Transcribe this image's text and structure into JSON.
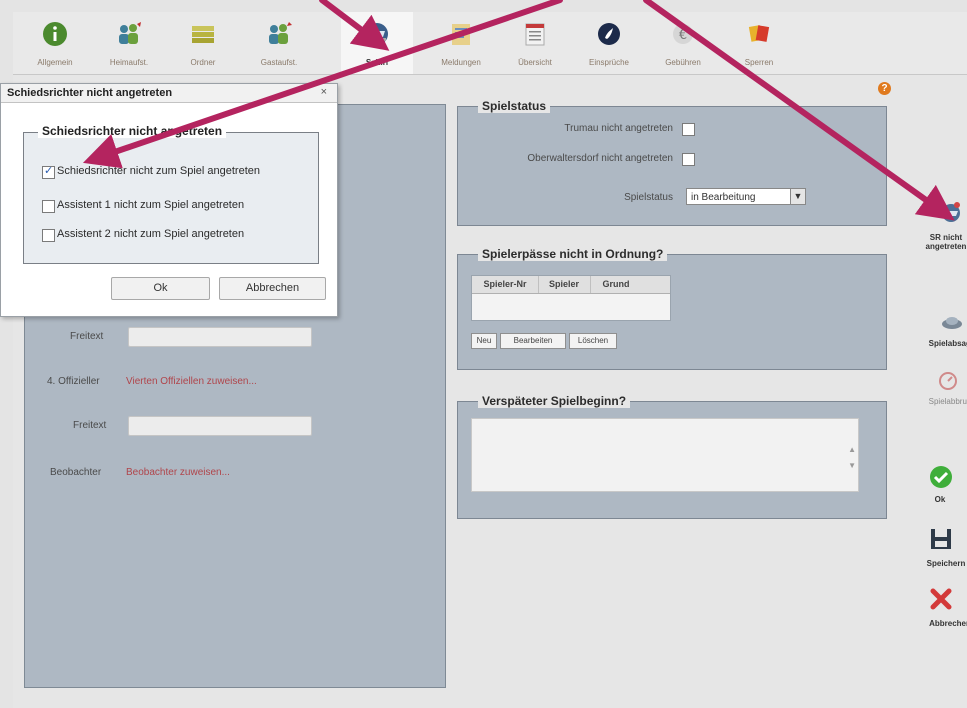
{
  "toolbar": {
    "items": [
      {
        "label": "Allgemein",
        "icon": "info-icon"
      },
      {
        "label": "Heimaufst.",
        "icon": "team-home-icon"
      },
      {
        "label": "Ordner",
        "icon": "folder-stack-icon"
      },
      {
        "label": "Gastaufst.",
        "icon": "team-guest-icon"
      },
      {
        "label": "Schiri",
        "icon": "referee-icon"
      },
      {
        "label": "Meldungen",
        "icon": "notes-icon"
      },
      {
        "label": "Übersicht",
        "icon": "list-icon"
      },
      {
        "label": "Einsprüche",
        "icon": "protest-icon"
      },
      {
        "label": "Gebühren",
        "icon": "fees-icon"
      },
      {
        "label": "Sperren",
        "icon": "cards-icon"
      }
    ]
  },
  "left": {
    "freitext1_label": "Freitext",
    "offizieller_label": "4. Offizieller",
    "offizieller_link": "Vierten Offiziellen zuweisen...",
    "freitext2_label": "Freitext",
    "beobachter_label": "Beobachter",
    "beobachter_link": "Beobachter zuweisen..."
  },
  "spielstatus": {
    "legend": "Spielstatus",
    "home_label": "Trumau nicht angetreten",
    "guest_label": "Oberwaltersdorf nicht angetreten",
    "status_label": "Spielstatus",
    "status_value": "in Bearbeitung"
  },
  "spielerpaesse": {
    "legend": "Spielerpässe nicht in Ordnung?",
    "columns": [
      "Spieler-Nr",
      "Spieler",
      "Grund"
    ],
    "btn_neu": "Neu",
    "btn_bearbeiten": "Bearbeiten",
    "btn_loeschen": "Löschen"
  },
  "verspaetet": {
    "legend": "Verspäteter Spielbeginn?"
  },
  "sidebar": {
    "sr": "SR nicht angetreten",
    "spielabsage": "Spielabsage",
    "spielabbruch": "Spielabbruch",
    "ok": "Ok",
    "save": "Speichern",
    "cancel": "Abbrechen"
  },
  "dialog": {
    "title": "Schiedsrichter nicht angetreten",
    "close": "×",
    "legend": "Schiedsrichter nicht angetreten",
    "options": [
      {
        "label": "Schiedsrichter nicht zum Spiel angetreten",
        "checked": true
      },
      {
        "label": "Assistent 1 nicht zum Spiel angetreten",
        "checked": false
      },
      {
        "label": "Assistent 2 nicht zum Spiel angetreten",
        "checked": false
      }
    ],
    "ok": "Ok",
    "cancel": "Abbrechen"
  },
  "colors": {
    "annotation_arrow": "#b4245f",
    "panel": "#aeb8c3",
    "link_red": "#b0454b"
  }
}
